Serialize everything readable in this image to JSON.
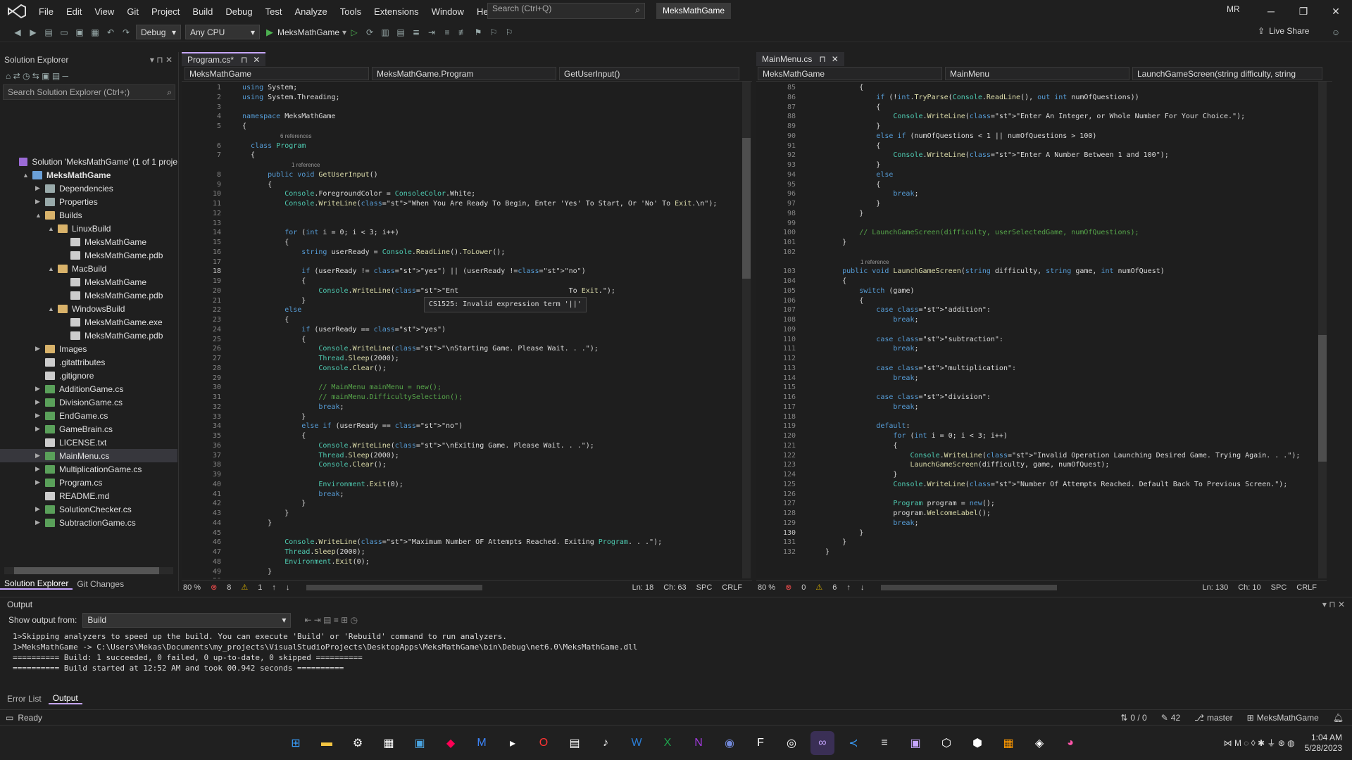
{
  "titlebar": {
    "menu": [
      "File",
      "Edit",
      "View",
      "Git",
      "Project",
      "Build",
      "Debug",
      "Test",
      "Analyze",
      "Tools",
      "Extensions",
      "Window",
      "Help"
    ],
    "search_placeholder": "Search (Ctrl+Q)",
    "solution_name": "MeksMathGame",
    "user_initials": "MR"
  },
  "toolbar": {
    "configuration": "Debug",
    "platform": "Any CPU",
    "run_target": "MeksMathGame",
    "live_share": "Live Share"
  },
  "solution_explorer": {
    "title": "Solution Explorer",
    "search_placeholder": "Search Solution Explorer (Ctrl+;)",
    "items": [
      {
        "label": "Solution 'MeksMathGame' (1 of 1 proje",
        "indent": 0,
        "exp": "",
        "icon": "solution-icon"
      },
      {
        "label": "MeksMathGame",
        "indent": 1,
        "exp": "▲",
        "icon": "project-icon",
        "bold": true
      },
      {
        "label": "Dependencies",
        "indent": 2,
        "exp": "▶",
        "icon": "dependencies-icon"
      },
      {
        "label": "Properties",
        "indent": 2,
        "exp": "▶",
        "icon": "properties-icon"
      },
      {
        "label": "Builds",
        "indent": 2,
        "exp": "▲",
        "icon": "folder-icon"
      },
      {
        "label": "LinuxBuild",
        "indent": 3,
        "exp": "▲",
        "icon": "folder-icon"
      },
      {
        "label": "MeksMathGame",
        "indent": 4,
        "exp": "",
        "icon": "file-icon"
      },
      {
        "label": "MeksMathGame.pdb",
        "indent": 4,
        "exp": "",
        "icon": "file-icon"
      },
      {
        "label": "MacBuild",
        "indent": 3,
        "exp": "▲",
        "icon": "folder-icon"
      },
      {
        "label": "MeksMathGame",
        "indent": 4,
        "exp": "",
        "icon": "file-icon"
      },
      {
        "label": "MeksMathGame.pdb",
        "indent": 4,
        "exp": "",
        "icon": "file-icon"
      },
      {
        "label": "WindowsBuild",
        "indent": 3,
        "exp": "▲",
        "icon": "folder-icon"
      },
      {
        "label": "MeksMathGame.exe",
        "indent": 4,
        "exp": "",
        "icon": "file-icon"
      },
      {
        "label": "MeksMathGame.pdb",
        "indent": 4,
        "exp": "",
        "icon": "file-icon"
      },
      {
        "label": "Images",
        "indent": 2,
        "exp": "▶",
        "icon": "folder-icon"
      },
      {
        "label": ".gitattributes",
        "indent": 2,
        "exp": "",
        "icon": "file-icon"
      },
      {
        "label": ".gitignore",
        "indent": 2,
        "exp": "",
        "icon": "file-icon"
      },
      {
        "label": "AdditionGame.cs",
        "indent": 2,
        "exp": "▶",
        "icon": "csharp-icon"
      },
      {
        "label": "DivisionGame.cs",
        "indent": 2,
        "exp": "▶",
        "icon": "csharp-icon"
      },
      {
        "label": "EndGame.cs",
        "indent": 2,
        "exp": "▶",
        "icon": "csharp-icon"
      },
      {
        "label": "GameBrain.cs",
        "indent": 2,
        "exp": "▶",
        "icon": "csharp-icon"
      },
      {
        "label": "LICENSE.txt",
        "indent": 2,
        "exp": "",
        "icon": "file-icon"
      },
      {
        "label": "MainMenu.cs",
        "indent": 2,
        "exp": "▶",
        "icon": "csharp-icon",
        "selected": true
      },
      {
        "label": "MultiplicationGame.cs",
        "indent": 2,
        "exp": "▶",
        "icon": "csharp-icon"
      },
      {
        "label": "Program.cs",
        "indent": 2,
        "exp": "▶",
        "icon": "csharp-icon"
      },
      {
        "label": "README.md",
        "indent": 2,
        "exp": "",
        "icon": "file-icon"
      },
      {
        "label": "SolutionChecker.cs",
        "indent": 2,
        "exp": "▶",
        "icon": "csharp-icon"
      },
      {
        "label": "SubtractionGame.cs",
        "indent": 2,
        "exp": "▶",
        "icon": "csharp-icon"
      }
    ],
    "bottom_tabs": [
      "Solution Explorer",
      "Git Changes"
    ]
  },
  "left_editor": {
    "tab": "Program.cs*",
    "nav": [
      "MeksMathGame",
      "MeksMathGame.Program",
      "GetUserInput()"
    ],
    "tooltip": "CS1525: Invalid expression term '||'",
    "status": {
      "zoom": "80 %",
      "errors": "8",
      "warnings": "1",
      "ln": "Ln: 18",
      "ch": "Ch: 63",
      "spc": "SPC",
      "eol": "CRLF"
    }
  },
  "right_editor": {
    "tab": "MainMenu.cs",
    "nav": [
      "MeksMathGame",
      "MainMenu",
      "LaunchGameScreen(string difficulty, string"
    ],
    "status": {
      "zoom": "80 %",
      "errors": "0",
      "warnings": "6",
      "ln": "Ln: 130",
      "ch": "Ch: 10",
      "spc": "SPC",
      "eol": "CRLF"
    }
  },
  "output": {
    "title": "Output",
    "show_from_label": "Show output from:",
    "source": "Build",
    "lines": [
      "1>Skipping analyzers to speed up the build. You can execute 'Build' or 'Rebuild' command to run analyzers.",
      "1>MeksMathGame -> C:\\Users\\Mekas\\Documents\\my_projects\\VisualStudioProjects\\DesktopApps\\MeksMathGame\\bin\\Debug\\net6.0\\MeksMathGame.dll",
      "========== Build: 1 succeeded, 0 failed, 0 up-to-date, 0 skipped ==========",
      "========== Build started at 12:52 AM and took 00.942 seconds =========="
    ],
    "bottom_tabs": [
      "Error List",
      "Output"
    ]
  },
  "statusbar": {
    "ready": "Ready",
    "changes": "0 / 0",
    "edits": "42",
    "branch": "master",
    "repo": "MeksMathGame"
  },
  "taskbar": {
    "time": "1:04 AM",
    "date": "5/28/2023"
  },
  "colors": {
    "accent": "#c6a6ff",
    "error": "#f14c4c",
    "warning": "#cca700",
    "ok": "#388a34"
  }
}
